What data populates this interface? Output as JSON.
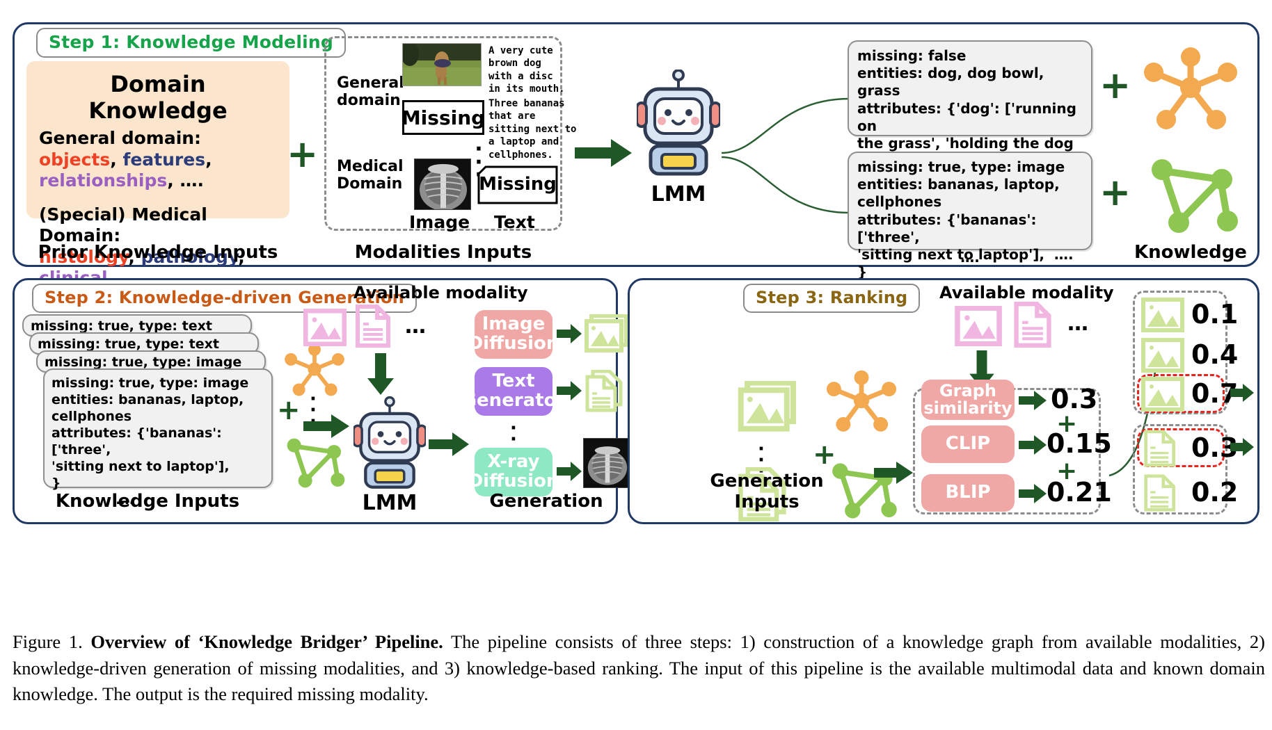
{
  "figure": {
    "caption_label": "Figure 1.",
    "caption_bold": "Overview of ‘Knowledge Bridger’ Pipeline.",
    "caption_rest": " The pipeline consists of three steps: 1) construction of a knowledge graph from available modalities, 2) knowledge-driven generation of missing modalities, and 3) knowledge-based ranking. The input of this pipeline is the available multimodal data and known domain knowledge. The output is the required missing modality."
  },
  "colors": {
    "panel_border": "#1f3864",
    "step1_accent": "#16a34a",
    "step2_accent": "#c85a16",
    "step3_accent": "#8a6512",
    "domain_box_bg": "#fbe5cd",
    "red_term": "#ef4123",
    "blue_term": "#2c3c7a",
    "purple_term": "#9a5fc0",
    "arrow_green": "#1f5727",
    "pink_pill": "#f0a8a6",
    "purple_pill": "#a97ae8",
    "mint_pill": "#8ee8c4",
    "orange_graph": "#f2a950",
    "green_graph": "#8ec652",
    "lightgreen_icon": "#cde49a",
    "pink_icon": "#f0c3e4",
    "highlight_red_dashed": "#e8241f"
  },
  "step1": {
    "badge": "Step 1: Knowledge Modeling",
    "domain_knowledge": {
      "title": "Domain Knowledge",
      "line1_prefix": "General domain: ",
      "line1_t1": "objects",
      "line1_sep1": ", ",
      "line1_t2": "features",
      "line1_sep2": ", ",
      "line1_t3": "relationships",
      "line1_suffix": ", ….",
      "line2_prefix": "(Special) Medical Domain:",
      "line2_t1": "histology",
      "line2_sep1": ", ",
      "line2_t2": "pathology",
      "line2_sep2": ",",
      "line2_t3": "clinical",
      "line2_suffix": ", …"
    },
    "caption_left": "Prior Knowledge Inputs",
    "caption_mid": "Modalities Inputs",
    "caption_right": "Knowledge",
    "plus_symbol": "+",
    "modalities": {
      "row1_label": "General\ndomain",
      "row2_label": "Medical\nDomain",
      "col_image_label": "Image",
      "col_text_label": "Text",
      "missing_label_1": "Missing",
      "missing_label_2": "Missing",
      "text_caption_1": "A very cute\nbrown dog\nwith a disc\nin its mouth.",
      "text_caption_2": "Three bananas\nthat are\nsitting next to\na laptop and\ncellphones.",
      "vdots": "⋮"
    },
    "lmm_label": "LMM",
    "knowledge_card_1": "missing: false\nentities: dog, dog bowl, grass\nattributes: {'dog': ['running on\nthe grass', 'holding the dog\nbowl'], ….}\n              ….",
    "knowledge_card_2": "missing: true, type: image\nentities: bananas, laptop,\ncellphones\nattributes: {'bananas': ['three',\n'sitting next to laptop'],  …. }\n              ….",
    "trailing_dots": "….",
    "plus_right_1": "+",
    "plus_right_2": "+"
  },
  "step2": {
    "badge": "Step 2: Knowledge-driven Generation",
    "available_modality_label": "Available modality",
    "hdots": "…",
    "stack_cards": [
      "missing: true, type: text",
      "missing: true, type: text",
      "missing: true, type: image"
    ],
    "main_card": "missing: true, type: image\nentities: bananas, laptop,\ncellphones\nattributes: {'bananas': ['three',\n'sitting next to laptop'],        }\n              ….",
    "plus_symbol": "+",
    "vdots": "⋮",
    "lmm_label": "LMM",
    "generators": [
      {
        "label": "Image\nDiffusion",
        "color": "#f0a8a6"
      },
      {
        "label": "Text\nGenerator",
        "color": "#a97ae8"
      },
      {
        "label": "X-ray\nDiffusion",
        "color": "#8ee8c4"
      }
    ],
    "generator_vdots": "⋮",
    "caption_left": "Knowledge Inputs",
    "caption_right": "Generation"
  },
  "step3": {
    "badge": "Step 3: Ranking",
    "available_modality_label": "Available modality",
    "hdots": "…",
    "vdots": "⋮",
    "plus_symbol": "+",
    "metrics": [
      {
        "label": "Graph\nsimilarity",
        "score": "0.3"
      },
      {
        "label": "CLIP",
        "score": "0.15"
      },
      {
        "label": "BLIP",
        "score": "0.21"
      }
    ],
    "plus_between_1": "+",
    "plus_between_2": "+",
    "caption_left": "Generation\nInputs",
    "ranked_images": [
      {
        "score": "0.1",
        "selected": false
      },
      {
        "score": "0.4",
        "selected": false
      },
      {
        "score": "0.7",
        "selected": true
      }
    ],
    "ranked_texts": [
      {
        "score": "0.3",
        "selected": true
      },
      {
        "score": "0.2",
        "selected": false
      }
    ]
  }
}
